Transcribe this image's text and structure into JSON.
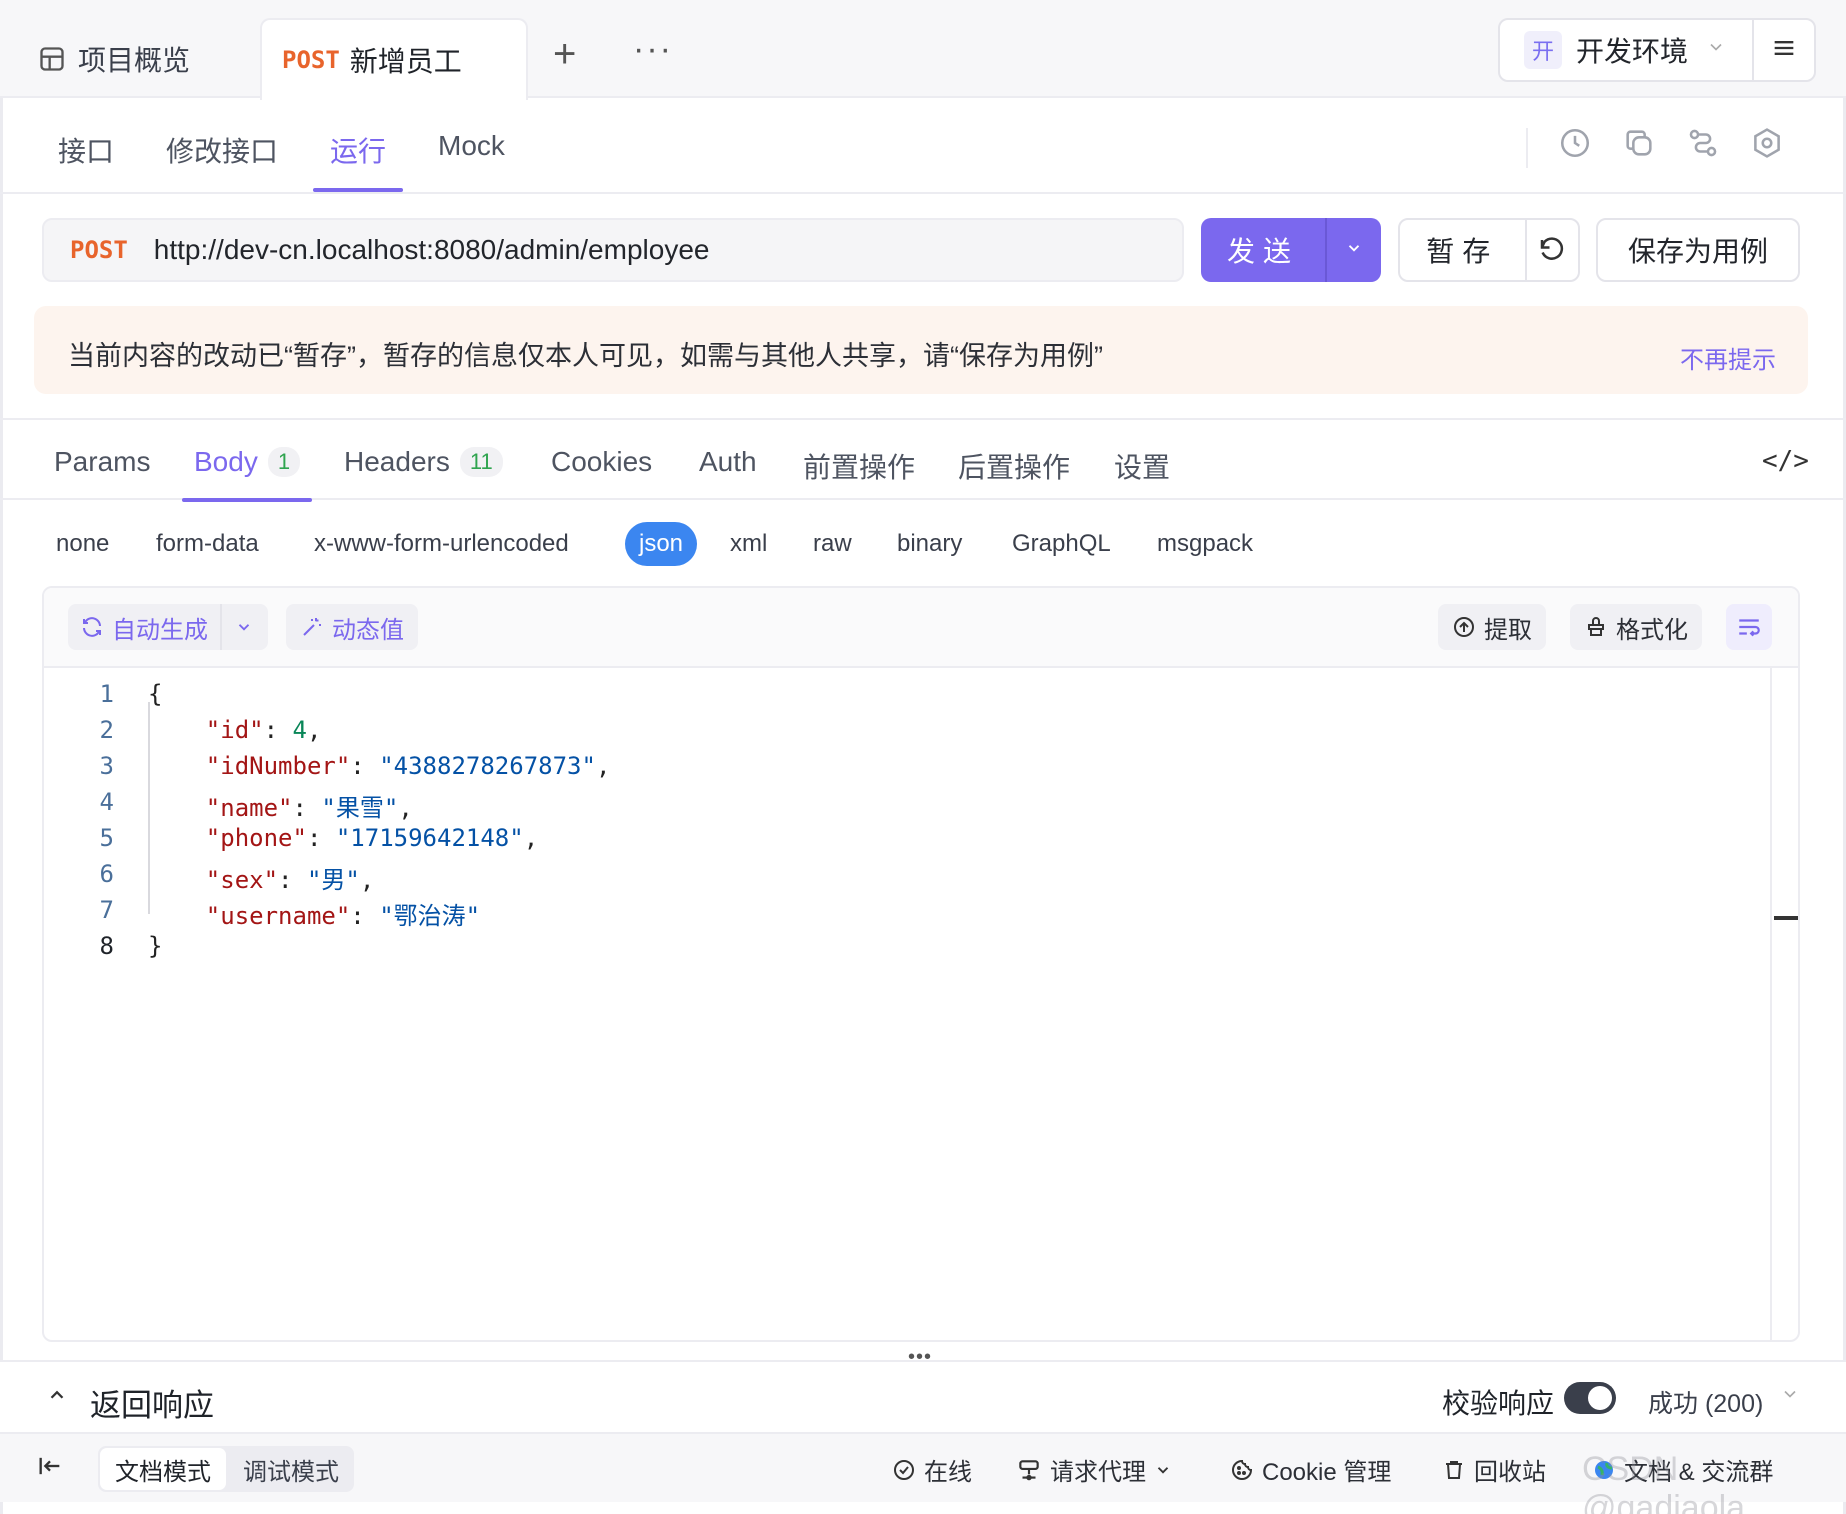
{
  "top_tabs": {
    "overview_label": "项目概览",
    "active_tab": {
      "method": "POST",
      "title": "新增员工"
    },
    "add_symbol": "+",
    "more_symbol": "···"
  },
  "environment": {
    "badge": "开",
    "label": "开发环境"
  },
  "sub_nav": {
    "items": [
      {
        "label": "接口"
      },
      {
        "label": "修改接口"
      },
      {
        "label": "运行"
      },
      {
        "label": "Mock"
      }
    ],
    "active": "运行"
  },
  "request": {
    "method": "POST",
    "url": "http://dev-cn.localhost:8080/admin/employee",
    "send_label": "发送",
    "stash_label": "暂存",
    "save_case_label": "保存为用例"
  },
  "notice": {
    "text": "当前内容的改动已“暂存”，暂存的信息仅本人可见，如需与其他人共享，请“保存为用例”",
    "dismiss_label": "不再提示"
  },
  "request_tabs": {
    "items": [
      {
        "label": "Params",
        "count": ""
      },
      {
        "label": "Body",
        "count": "1"
      },
      {
        "label": "Headers",
        "count": "11"
      },
      {
        "label": "Cookies",
        "count": ""
      },
      {
        "label": "Auth",
        "count": ""
      },
      {
        "label": "前置操作",
        "count": ""
      },
      {
        "label": "后置操作",
        "count": ""
      },
      {
        "label": "设置",
        "count": ""
      }
    ],
    "active": "Body",
    "code_toggle": "</>"
  },
  "body_types": {
    "items": [
      "none",
      "form-data",
      "x-www-form-urlencoded",
      "json",
      "xml",
      "raw",
      "binary",
      "GraphQL",
      "msgpack"
    ],
    "active": "json"
  },
  "editor": {
    "auto_generate_label": "自动生成",
    "dynamic_value_label": "动态值",
    "extract_label": "提取",
    "format_label": "格式化",
    "line_numbers": [
      "1",
      "2",
      "3",
      "4",
      "5",
      "6",
      "7",
      "8"
    ],
    "current_line": "8",
    "json": {
      "open": "{",
      "close": "}",
      "fields": [
        {
          "key": "\"id\"",
          "value": "4",
          "type": "number"
        },
        {
          "key": "\"idNumber\"",
          "value": "\"4388278267873\"",
          "type": "string"
        },
        {
          "key": "\"name\"",
          "value": "\"果雪\"",
          "type": "string"
        },
        {
          "key": "\"phone\"",
          "value": "\"17159642148\"",
          "type": "string"
        },
        {
          "key": "\"sex\"",
          "value": "\"男\"",
          "type": "string"
        },
        {
          "key": "\"username\"",
          "value": "\"鄂治涛\"",
          "type": "string"
        }
      ]
    }
  },
  "response": {
    "title": "返回响应",
    "verify_label": "校验响应",
    "verify_enabled": true,
    "status": "成功 (200)"
  },
  "footer": {
    "doc_mode": "文档模式",
    "debug_mode": "调试模式",
    "online": "在线",
    "proxy": "请求代理",
    "cookie": "Cookie 管理",
    "recycle": "回收站",
    "docs_group": "文档 & 交流群"
  },
  "watermark": "CSDN @gadiaola",
  "colors": {
    "accent": "#7b68ee",
    "method": "#e8642c",
    "json_pill": "#3b86f0"
  }
}
